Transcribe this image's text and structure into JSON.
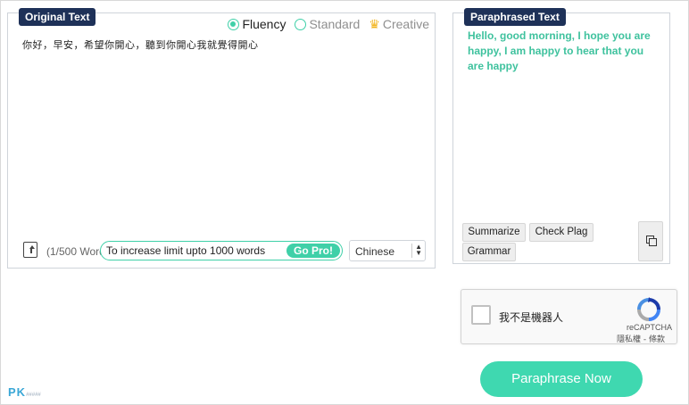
{
  "original": {
    "tag": "Original Text",
    "modes": [
      {
        "label": "Fluency",
        "selected": true
      },
      {
        "label": "Standard",
        "selected": false
      },
      {
        "label": "Creative",
        "selected": false,
        "premium": true
      }
    ],
    "input_text": "你好，早安，希望你開心，聽到你開心我就覺得開心",
    "word_count": "(1/500 Words)",
    "limit_text": "To increase limit upto 1000 words",
    "gopro_label": "Go Pro!",
    "language": "Chinese"
  },
  "paraphrased": {
    "tag": "Paraphrased Text",
    "output_text": "Hello, good morning, I hope you are happy, I am happy to hear that you are happy",
    "tools": [
      "Summarize",
      "Check Plag",
      "Grammar"
    ]
  },
  "captcha": {
    "label": "我不是機器人",
    "brand": "reCAPTCHA",
    "links": "隱私權 - 條款"
  },
  "action": {
    "paraphrase_label": "Paraphrase Now"
  },
  "watermark": {
    "text": "PK",
    "subtext": "#####"
  },
  "colors": {
    "accent": "#3fd0a8",
    "tag_bg": "#1e3158",
    "output_text": "#3fc29e"
  }
}
